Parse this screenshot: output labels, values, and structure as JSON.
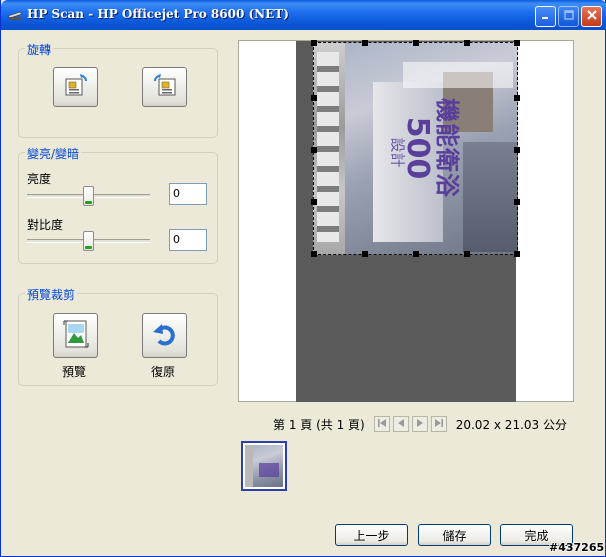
{
  "window": {
    "title": "HP Scan - HP Officejet Pro 8600 (NET)"
  },
  "rotate_group": {
    "title": "旋轉",
    "rotate_left_icon": "rotate-left-icon",
    "rotate_right_icon": "rotate-right-icon"
  },
  "brightness_group": {
    "title": "變亮/變暗",
    "brightness_label": "亮度",
    "brightness_value": "0",
    "contrast_label": "對比度",
    "contrast_value": "0"
  },
  "crop_group": {
    "title": "預覽裁剪",
    "preview_label": "預覽",
    "restore_label": "復原"
  },
  "preview": {
    "scan_text_main": "機能衛浴",
    "scan_text_sub": "設計",
    "scan_number": "500"
  },
  "pager": {
    "page_text": "第 1 頁 (共 1 頁)",
    "dimensions": "20.02 x 21.03 公分"
  },
  "buttons": {
    "back": "上一步",
    "save": "儲存",
    "done": "完成"
  },
  "watermark": "#437265",
  "colors": {
    "title_bar": "#0b58d8",
    "group_title": "#0046d5",
    "window_bg": "#ece9d8"
  }
}
